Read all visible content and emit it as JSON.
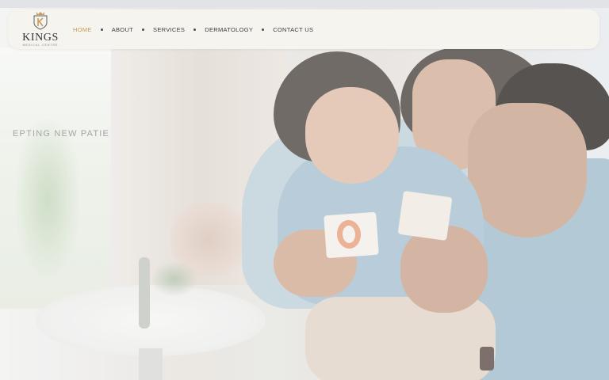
{
  "brand": {
    "name": "KINGS",
    "subtitle": "MEDICAL CENTRE",
    "crest_letter": "K"
  },
  "nav": {
    "items": [
      {
        "label": "HOME",
        "active": true
      },
      {
        "label": "ABOUT",
        "active": false
      },
      {
        "label": "SERVICES",
        "active": false
      },
      {
        "label": "DERMATOLOGY",
        "active": false
      },
      {
        "label": "CONTACT US",
        "active": false
      }
    ]
  },
  "hero": {
    "tagline": "EPTING NEW PATIE"
  },
  "colors": {
    "accent": "#c99a58",
    "nav_text": "#3a3d42",
    "navbar_bg": "#f6f4ef"
  }
}
